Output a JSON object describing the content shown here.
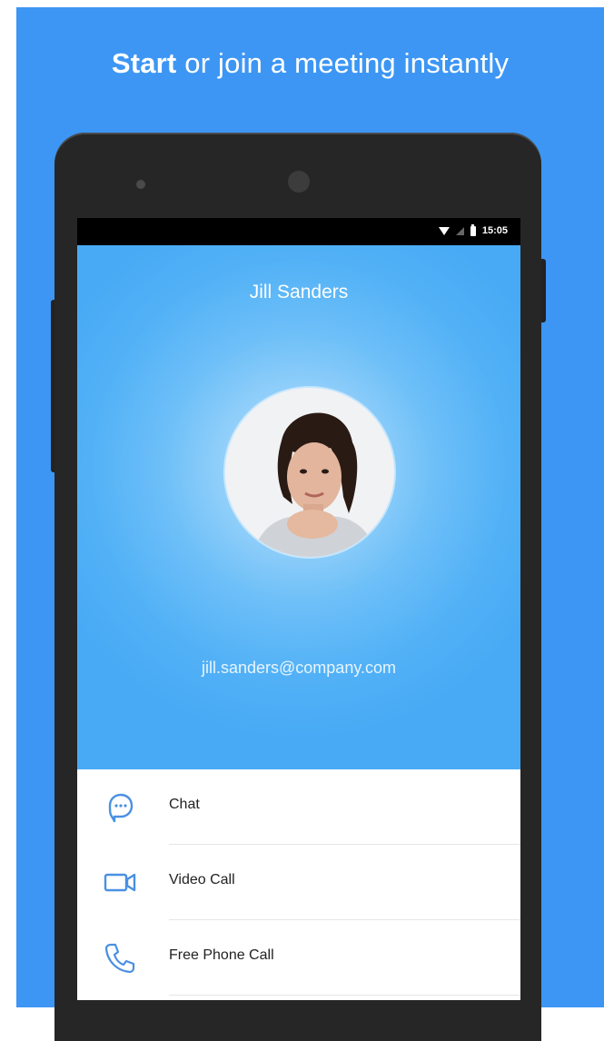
{
  "headline": {
    "bold": "Start",
    "rest": " or join a meeting instantly"
  },
  "status_bar": {
    "time": "15:05"
  },
  "profile": {
    "name": "Jill Sanders",
    "email": "jill.sanders@company.com"
  },
  "actions": [
    {
      "label": "Chat",
      "icon": "chat-bubble-icon"
    },
    {
      "label": "Video Call",
      "icon": "video-camera-icon"
    },
    {
      "label": "Free Phone Call",
      "icon": "phone-icon"
    }
  ],
  "colors": {
    "background": "#3d96f4",
    "screen": "#48aaf5",
    "icon_accent": "#4a90e2"
  }
}
